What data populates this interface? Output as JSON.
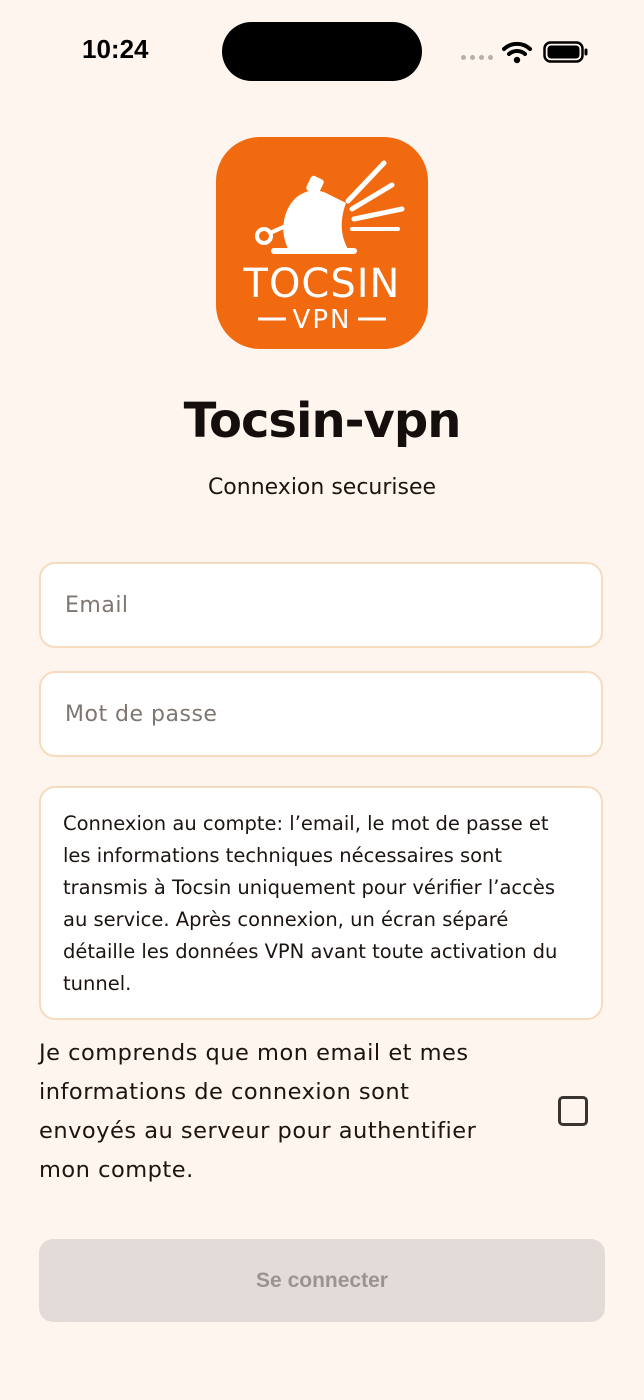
{
  "status_bar": {
    "time": "10:24",
    "icons": [
      "cellular-signal-icon",
      "wifi-icon",
      "battery-icon"
    ]
  },
  "app": {
    "logo": {
      "brand_text": "TOCSIN",
      "sub_text": "VPN",
      "color": "#f26a10"
    },
    "title": "Tocsin-vpn",
    "subtitle": "Connexion securisee"
  },
  "form": {
    "email": {
      "value": "",
      "placeholder": "Email"
    },
    "password": {
      "value": "",
      "placeholder": "Mot de passe"
    },
    "notice": "Connexion au compte: l’email, le mot de passe et les informations techniques nécessaires sont transmis à Tocsin uniquement pour vérifier l’accès au service. Après connexion, un écran séparé détaille les données VPN avant toute activation du tunnel.",
    "consent": {
      "label": "Je comprends que mon email et mes informations de connexion sont envoyés au serveur pour authentifier mon compte.",
      "checked": false
    },
    "submit_label": "Se connecter",
    "submit_disabled": true
  },
  "colors": {
    "background": "#fff5ef",
    "field_border": "#f6dcbf",
    "brand_orange": "#f26a10",
    "disabled_button": "#e3dbd7",
    "disabled_text": "#9b9390"
  }
}
